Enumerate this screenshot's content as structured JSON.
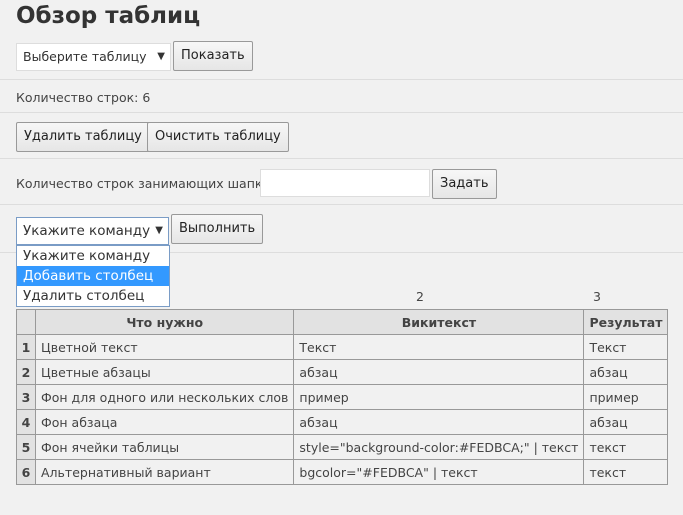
{
  "title": "Обзор таблиц",
  "table_select": {
    "value": "Выберите таблицу"
  },
  "show_button": "Показать",
  "row_count": "Количество строк: 6",
  "delete_table": "Удалить таблицу",
  "clear_table": "Очистить таблицу",
  "header_rows_label": "Количество строк занимающих шапку",
  "header_rows_value": "",
  "set_button": "Задать",
  "command_select": {
    "value": "Укажите команду",
    "options": [
      "Укажите команду",
      "Добавить столбец",
      "Удалить столбец"
    ],
    "highlighted": 1
  },
  "execute_button": "Выполнить",
  "column_numbers": [
    "2",
    "3"
  ],
  "table": {
    "headers": [
      "Что нужно",
      "Викитекст",
      "Результат"
    ],
    "rows": [
      [
        "1",
        "Цветной текст",
        "Текст",
        "Текст"
      ],
      [
        "2",
        "Цветные абзацы",
        "абзац",
        "абзац"
      ],
      [
        "3",
        "Фон для одного или нескольких слов",
        "пример",
        "пример"
      ],
      [
        "4",
        "Фон абзаца",
        "абзац",
        "абзац"
      ],
      [
        "5",
        "Фон ячейки таблицы",
        "style=\"background-color:#FEDBCA;\" | текст",
        "текст"
      ],
      [
        "6",
        "Альтернативный вариант",
        "bgcolor=\"#FEDBCA\" | текст",
        "текст"
      ]
    ]
  },
  "colors": {
    "highlight": "#3399ff",
    "background": "#f1f1f1"
  }
}
